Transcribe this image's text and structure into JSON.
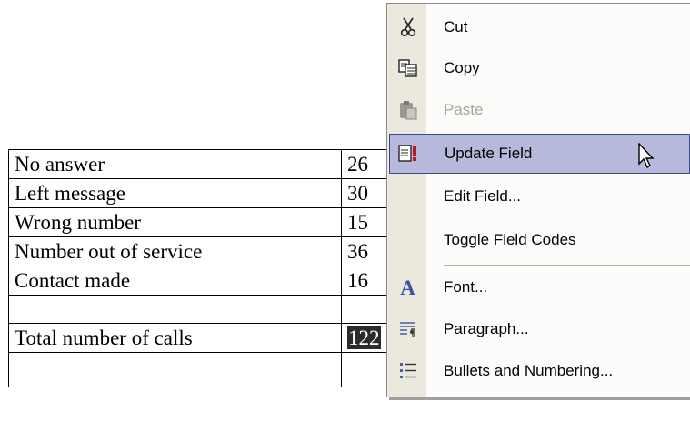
{
  "table": {
    "rows": [
      {
        "label": "No answer",
        "value": "26"
      },
      {
        "label": "Left message",
        "value": "30"
      },
      {
        "label": "Wrong number",
        "value": "15"
      },
      {
        "label": "Number out of service",
        "value": "36"
      },
      {
        "label": "Contact made",
        "value": "16"
      },
      {
        "label": "",
        "value": ""
      },
      {
        "label": "Total number of calls",
        "value": "122"
      },
      {
        "label": "",
        "value": ""
      }
    ]
  },
  "context_menu": {
    "items": [
      {
        "label": "Cut",
        "icon": "scissors-icon",
        "enabled": true
      },
      {
        "label": "Copy",
        "icon": "copy-icon",
        "enabled": true
      },
      {
        "label": "Paste",
        "icon": "paste-icon",
        "enabled": false
      },
      {
        "label": "Update Field",
        "icon": "update-field-icon",
        "enabled": true,
        "highlighted": true
      },
      {
        "label": "Edit Field...",
        "icon": "",
        "enabled": true
      },
      {
        "label": "Toggle Field Codes",
        "icon": "",
        "enabled": true
      },
      {
        "label": "Font...",
        "icon": "font-icon",
        "enabled": true
      },
      {
        "label": "Paragraph...",
        "icon": "paragraph-icon",
        "enabled": true
      },
      {
        "label": "Bullets and Numbering...",
        "icon": "bullets-icon",
        "enabled": true
      }
    ]
  },
  "colors": {
    "highlight_bg": "#b5b9dc",
    "highlight_border": "#3b4a8c",
    "menu_gutter": "#ebe8de",
    "disabled_text": "#a8a59c"
  }
}
